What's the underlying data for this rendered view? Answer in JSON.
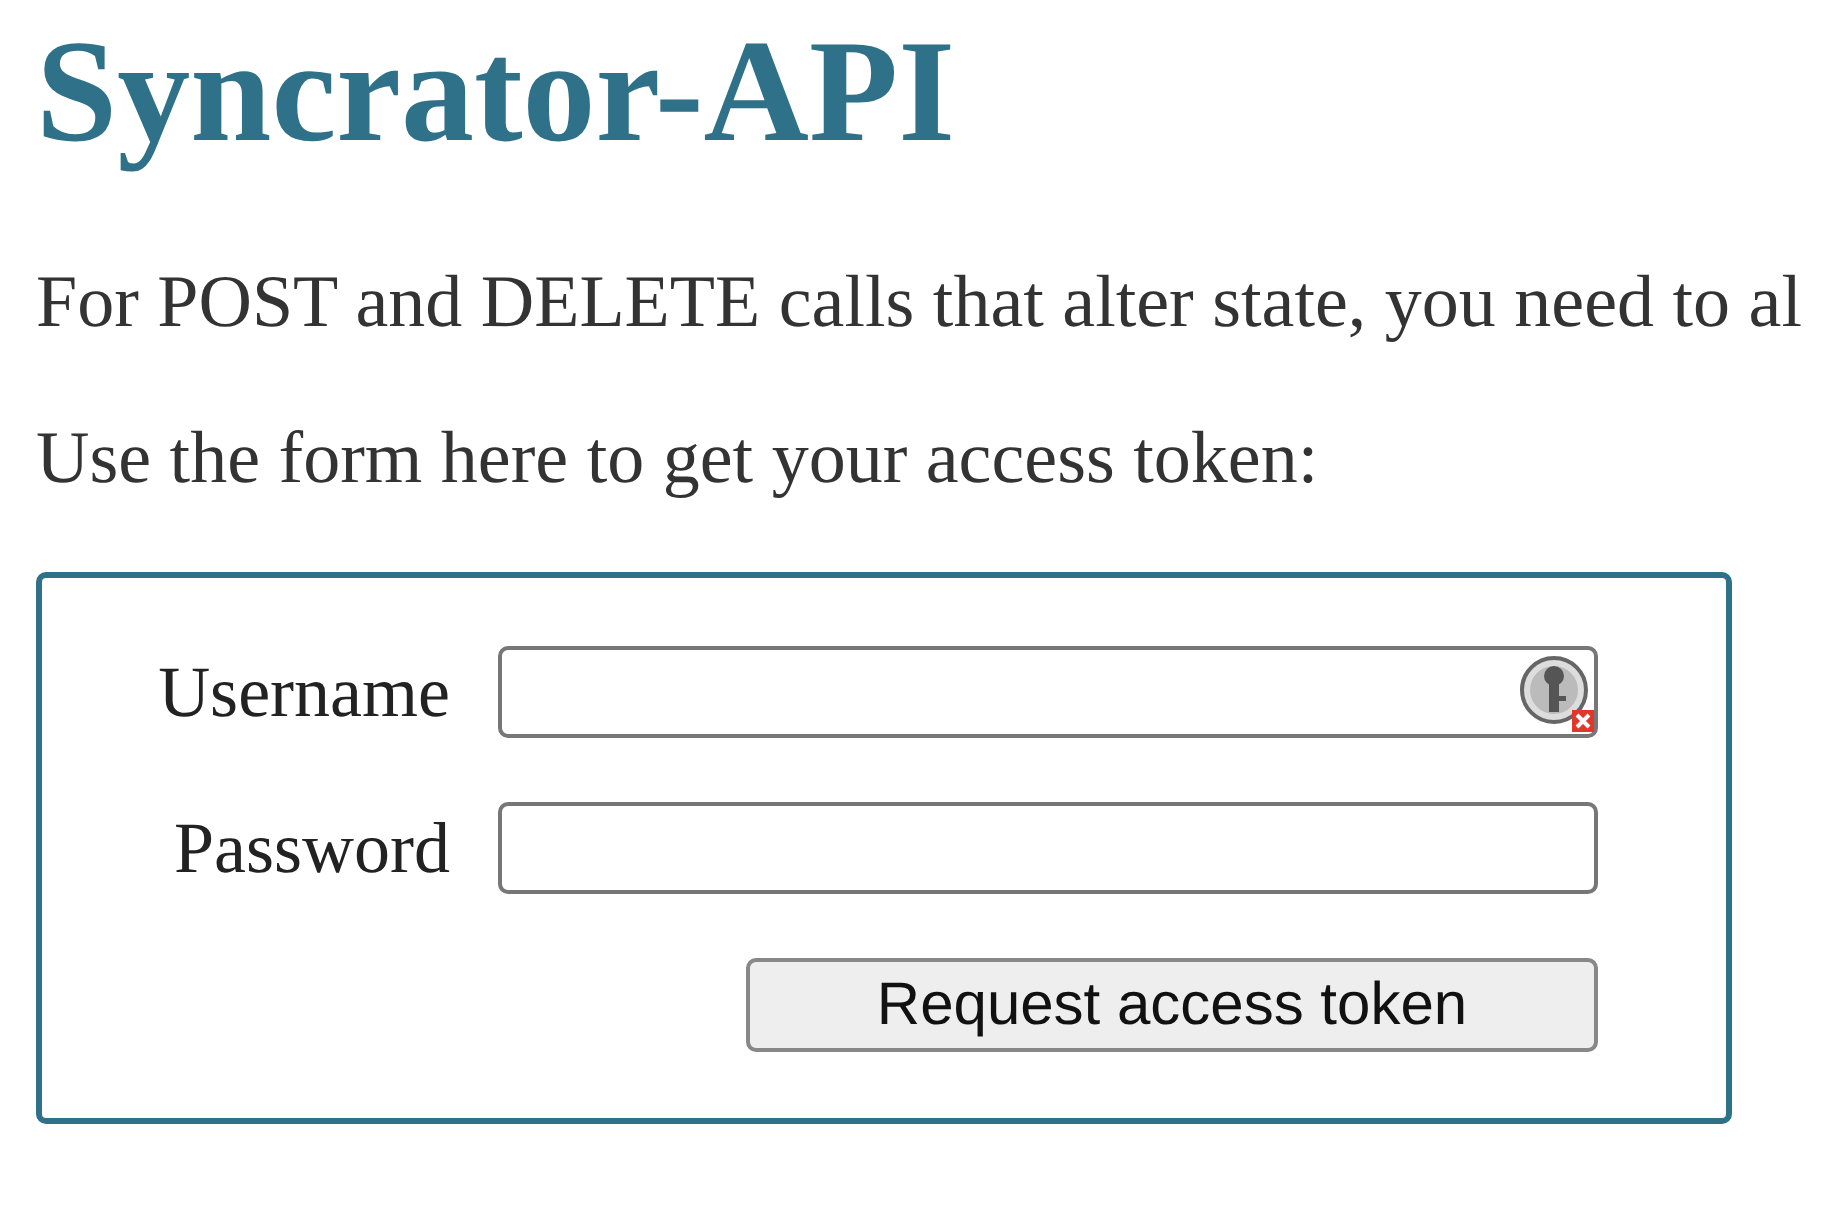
{
  "title": "Syncrator-API",
  "paragraphs": [
    "For POST and DELETE calls that alter state, you need to al",
    "Use the form here to get your access token:"
  ],
  "form": {
    "fields": [
      {
        "label": "Username",
        "password_manager_icon": true
      },
      {
        "label": "Password",
        "password_manager_icon": false
      }
    ],
    "button": "Request access token"
  }
}
